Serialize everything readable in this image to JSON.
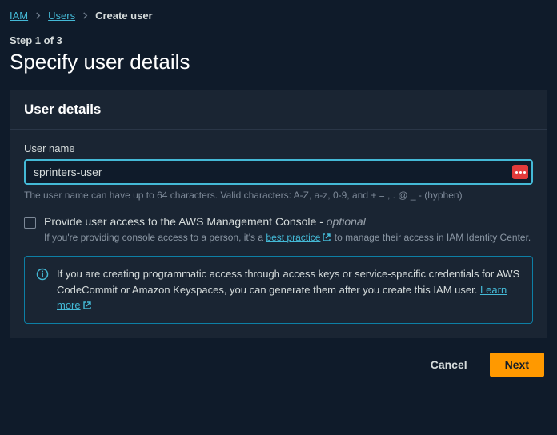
{
  "breadcrumb": {
    "iam": "IAM",
    "users": "Users",
    "current": "Create user"
  },
  "step": "Step 1 of 3",
  "title": "Specify user details",
  "panel": {
    "heading": "User details",
    "username_label": "User name",
    "username_value": "sprinters-user",
    "username_help": "The user name can have up to 64 characters. Valid characters: A-Z, a-z, 0-9, and + = , . @ _ - (hyphen)",
    "console_access_label": "Provide user access to the AWS Management Console - ",
    "console_access_optional": "optional",
    "console_access_help_before": "If you're providing console access to a person, it's a ",
    "console_access_help_link": "best practice",
    "console_access_help_after": " to manage their access in IAM Identity Center.",
    "info_text": "If you are creating programmatic access through access keys or service-specific credentials for AWS CodeCommit or Amazon Keyspaces, you can generate them after you create this IAM user. ",
    "info_link": "Learn more"
  },
  "footer": {
    "cancel": "Cancel",
    "next": "Next"
  }
}
